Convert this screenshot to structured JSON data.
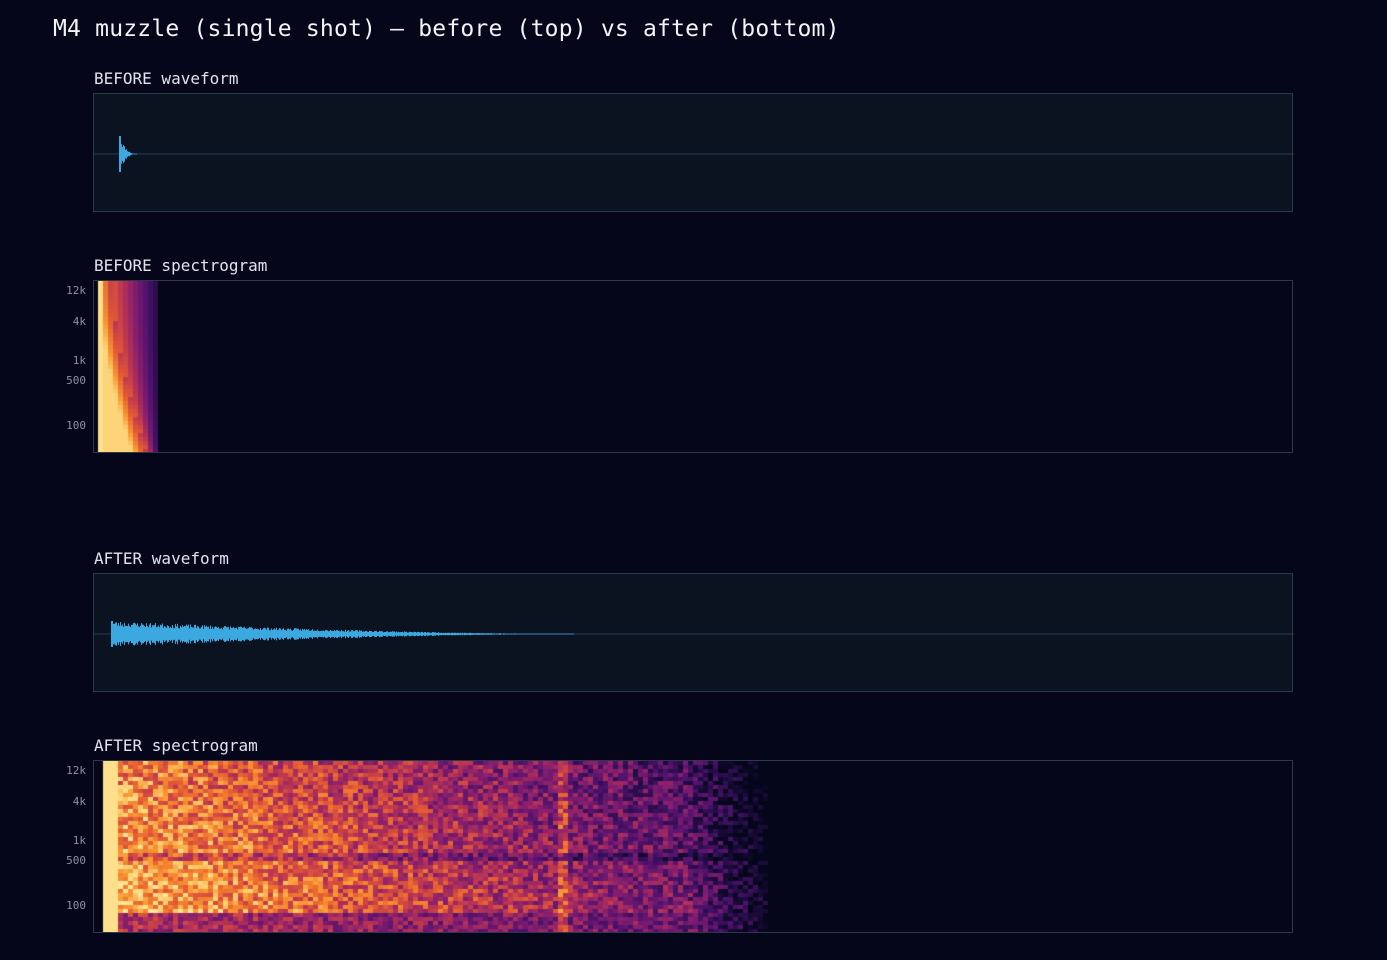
{
  "title": "M4 muzzle (single shot) — before (top) vs after (bottom)",
  "colors": {
    "background": "#05061a",
    "panel_bg": "#0c1320",
    "panel_border": "#2d3848",
    "waveform": "#3ba9e0",
    "centerline": "#1f3c52"
  },
  "panels": {
    "before_waveform": {
      "label": "BEFORE waveform",
      "decay_end_fraction": 0.035
    },
    "before_spectrogram": {
      "label": "BEFORE spectrogram",
      "y_ticks": [
        "12k",
        "4k",
        "1k",
        "500",
        "100"
      ],
      "energy_end_fraction": 0.052
    },
    "after_waveform": {
      "label": "AFTER waveform",
      "decay_end_fraction": 0.4
    },
    "after_spectrogram": {
      "label": "AFTER spectrogram",
      "y_ticks": [
        "12k",
        "4k",
        "1k",
        "500",
        "100"
      ],
      "energy_end_fraction": 0.56
    }
  }
}
